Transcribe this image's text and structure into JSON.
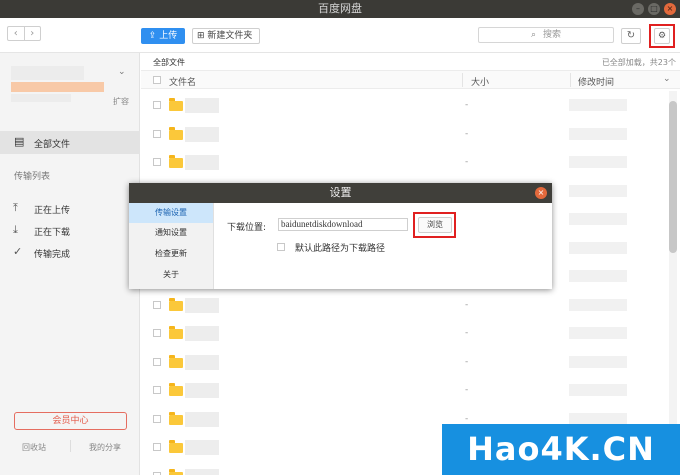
{
  "window": {
    "title": "百度网盘"
  },
  "toolbar": {
    "upload_label": "上传",
    "new_folder_label": "新建文件夹",
    "search_placeholder": "搜索"
  },
  "sidebar": {
    "expand_label": "扩容",
    "all_files": "全部文件",
    "transfer_list": "传输列表",
    "uploading": "正在上传",
    "downloading": "正在下载",
    "completed": "传输完成",
    "vip_button": "会员中心",
    "recycle_bin": "回收站",
    "my_shares": "我的分享"
  },
  "main": {
    "breadcrumb": "全部文件",
    "load_info": "已全部加载，共23个",
    "columns": {
      "name": "文件名",
      "size": "大小",
      "modified": "修改时间"
    },
    "row_size_placeholder": "-"
  },
  "settings_dialog": {
    "title": "设置",
    "tabs": [
      "传输设置",
      "通知设置",
      "检查更新",
      "关于"
    ],
    "download_location_label": "下载位置:",
    "download_path": "baidunetdiskdownload",
    "browse_button": "浏览",
    "default_path_label": "默认此路径为下载路径"
  },
  "watermark": "Hao4K.CN",
  "colors": {
    "accent": "#2f8ff0",
    "highlight": "#e02020",
    "folder": "#fbc83a"
  }
}
